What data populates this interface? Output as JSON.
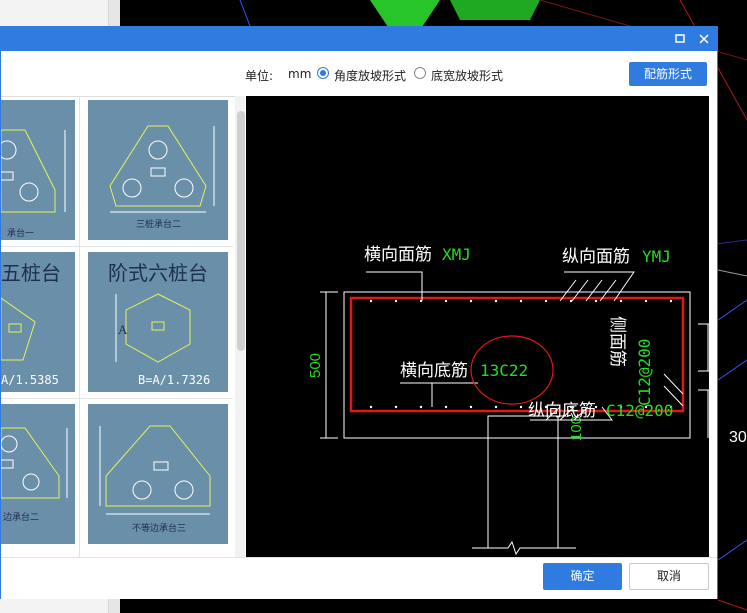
{
  "background": {
    "cad_label": "30"
  },
  "dialog": {
    "unit_label": "单位:",
    "unit_value": "mm",
    "option_angle": "角度放坡形式",
    "option_width": "底宽放坡形式",
    "rebar_button": "配筋形式",
    "ok_button": "确定",
    "cancel_button": "取消"
  },
  "gallery": {
    "items": [
      {
        "caption": "承台一"
      },
      {
        "caption": "三桩承台二"
      },
      {
        "title": "五桩台",
        "caption": "A/1.5385"
      },
      {
        "title": "阶式六桩台",
        "dim": "A",
        "caption": "B=A/1.7326"
      },
      {
        "caption": "边承台二"
      },
      {
        "caption": "不等边承台三"
      }
    ]
  },
  "preview": {
    "label_h_top": "横向面筋",
    "code_h_top": "XMJ",
    "label_v_top": "纵向面筋",
    "code_v_top": "YMJ",
    "label_h_bottom": "横向底筋",
    "code_h_bottom": "13C22",
    "label_v_bottom": "纵向底筋",
    "code_v_bottom": "C12@200",
    "label_side": "侧面筋",
    "code_side": "C12@200",
    "dim_height": "500",
    "dim_cover": "100"
  },
  "colors": {
    "accent": "#2f7be0",
    "cad_green": "#22dd22",
    "rebar_red": "#e01818",
    "thumb_bg": "#6a8fa8"
  }
}
